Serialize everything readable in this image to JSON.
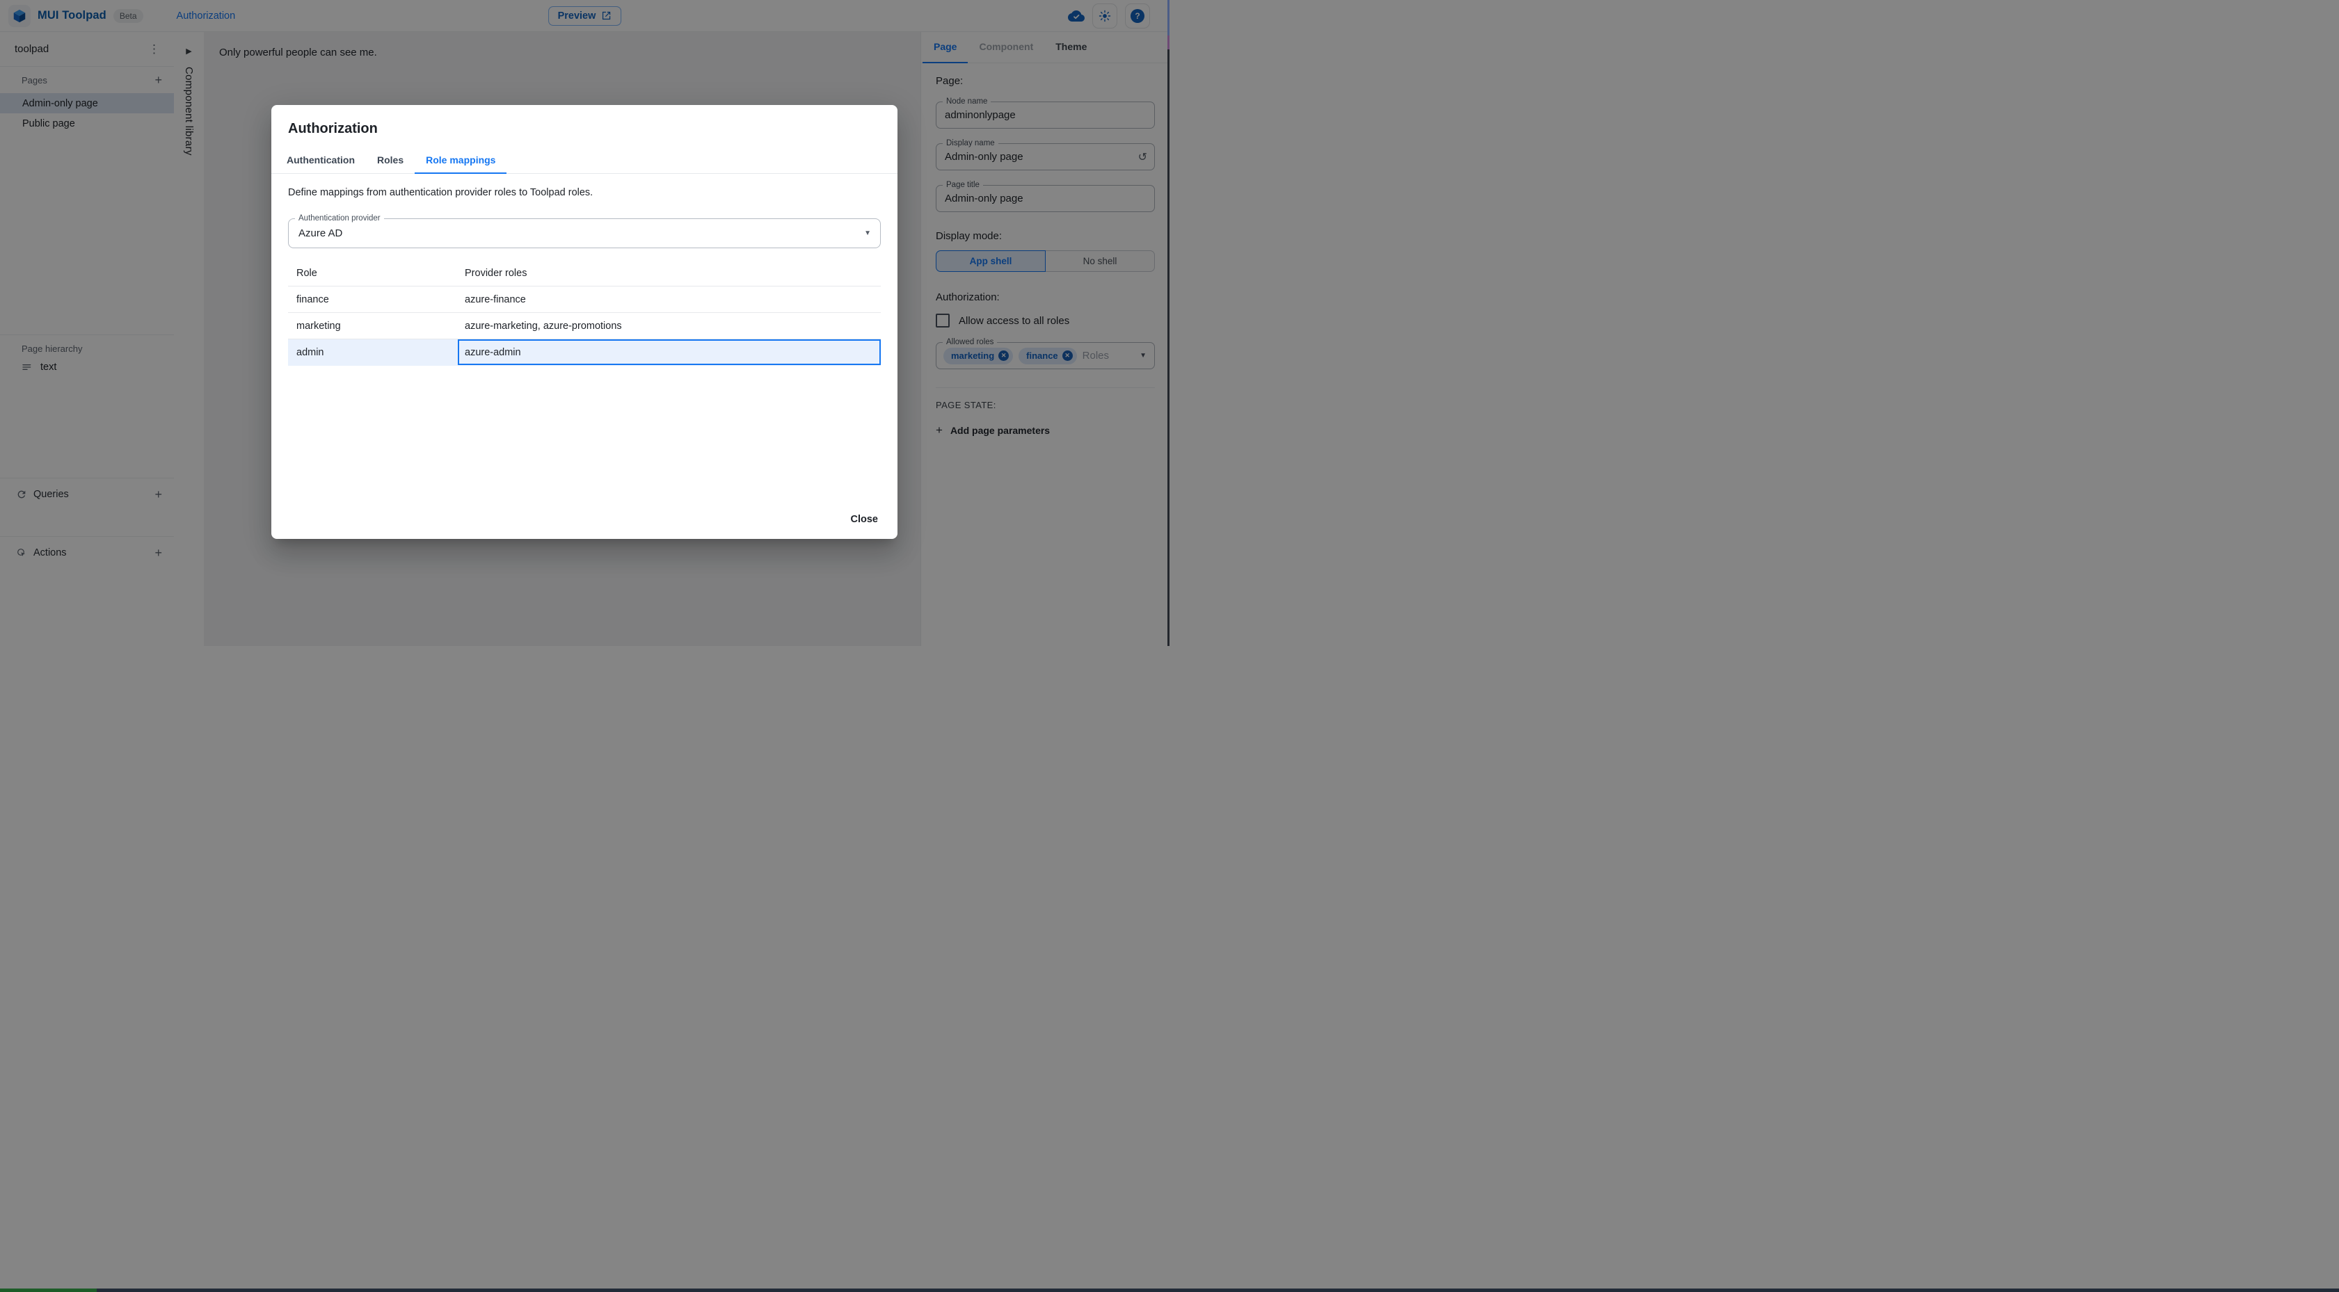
{
  "header": {
    "app_title": "MUI Toolpad",
    "beta_badge": "Beta",
    "breadcrumb": "Authorization",
    "preview_button": "Preview",
    "icons": [
      "mui-logo-icon",
      "open-in-new-icon",
      "cloud-done-icon",
      "sun-icon",
      "help-icon"
    ]
  },
  "sidebar": {
    "project_name": "toolpad",
    "pages": {
      "header": "Pages",
      "items": [
        {
          "label": "Admin-only page",
          "selected": true
        },
        {
          "label": "Public page",
          "selected": false
        }
      ]
    },
    "hierarchy": {
      "header": "Page hierarchy",
      "items": [
        {
          "label": "text"
        }
      ]
    },
    "queries": {
      "label": "Queries"
    },
    "actions": {
      "label": "Actions"
    }
  },
  "component_library": {
    "label": "Component library"
  },
  "canvas": {
    "content_text": "Only powerful people can see me."
  },
  "dialog": {
    "title": "Authorization",
    "tabs": [
      {
        "label": "Authentication",
        "active": false
      },
      {
        "label": "Roles",
        "active": false
      },
      {
        "label": "Role mappings",
        "active": true
      }
    ],
    "description": "Define mappings from authentication provider roles to Toolpad roles.",
    "provider_field": {
      "label": "Authentication provider",
      "value": "Azure AD"
    },
    "table": {
      "columns": [
        "Role",
        "Provider roles"
      ],
      "rows": [
        {
          "role": "finance",
          "provider_roles": "azure-finance",
          "selected": false
        },
        {
          "role": "marketing",
          "provider_roles": "azure-marketing, azure-promotions",
          "selected": false
        },
        {
          "role": "admin",
          "provider_roles": "azure-admin",
          "selected": true
        }
      ]
    },
    "close_button": "Close"
  },
  "inspector": {
    "tabs": [
      {
        "label": "Page",
        "active": true
      },
      {
        "label": "Component",
        "disabled": true
      },
      {
        "label": "Theme",
        "active": false
      }
    ],
    "heading": "Page:",
    "fields": {
      "node_name": {
        "label": "Node name",
        "value": "adminonlypage"
      },
      "display_name": {
        "label": "Display name",
        "value": "Admin-only page"
      },
      "page_title": {
        "label": "Page title",
        "value": "Admin-only page"
      }
    },
    "display_mode": {
      "label": "Display mode:",
      "options": [
        {
          "label": "App shell",
          "selected": true
        },
        {
          "label": "No shell",
          "selected": false
        }
      ]
    },
    "authorization": {
      "label": "Authorization:",
      "allow_all_label": "Allow access to all roles",
      "allow_all_checked": false,
      "allowed_roles": {
        "label": "Allowed roles",
        "chips": [
          "marketing",
          "finance"
        ],
        "placeholder": "Roles"
      }
    },
    "page_state": {
      "label": "PAGE STATE:",
      "add_button": "Add page parameters"
    }
  },
  "colors": {
    "primary": "#1677f2",
    "brand_blue": "#0b5cad",
    "selected_row_bg": "#e9f1fd",
    "sidebar_selected_bg": "#dbe5f1",
    "backdrop": "rgba(0,0,0,0.48)"
  }
}
